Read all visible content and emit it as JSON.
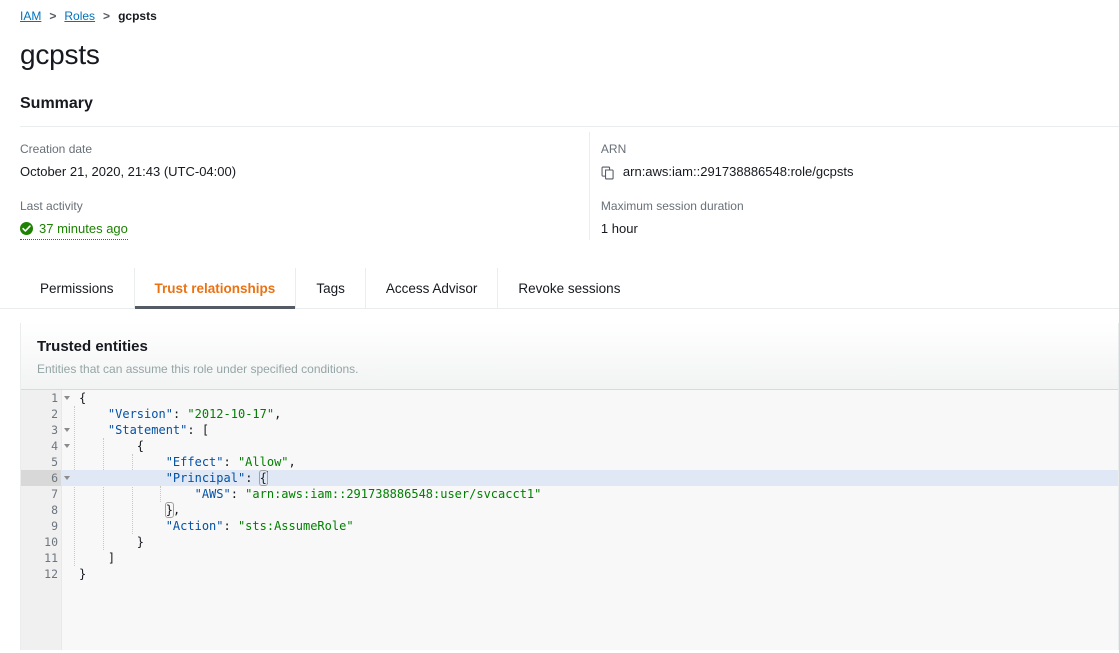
{
  "breadcrumb": {
    "items": [
      {
        "label": "IAM",
        "link": true
      },
      {
        "label": "Roles",
        "link": true
      },
      {
        "label": "gcpsts",
        "link": false
      }
    ],
    "separator": ">"
  },
  "page_title": "gcpsts",
  "summary": {
    "heading": "Summary",
    "left": {
      "creation_date_label": "Creation date",
      "creation_date_value": "October 21, 2020, 21:43 (UTC-04:00)",
      "last_activity_label": "Last activity",
      "last_activity_value": "37 minutes ago",
      "last_activity_icon": "check-circle-icon",
      "last_activity_color": "#1d8102"
    },
    "right": {
      "arn_label": "ARN",
      "arn_value": "arn:aws:iam::291738886548:role/gcpsts",
      "arn_copy_icon": "copy-icon",
      "max_session_label": "Maximum session duration",
      "max_session_value": "1 hour"
    }
  },
  "tabs": {
    "active_color": "#ec7211",
    "items": [
      {
        "label": "Permissions",
        "active": false
      },
      {
        "label": "Trust relationships",
        "active": true
      },
      {
        "label": "Tags",
        "active": false
      },
      {
        "label": "Access Advisor",
        "active": false
      },
      {
        "label": "Revoke sessions",
        "active": false
      }
    ]
  },
  "trusted_entities": {
    "title": "Trusted entities",
    "description": "Entities that can assume this role under specified conditions."
  },
  "editor": {
    "active_line": 6,
    "cursor_line": 6,
    "colors": {
      "key": "#0451a5",
      "string": "#008000",
      "active_line_bg": "#dfe8f4"
    },
    "lines": [
      {
        "n": 1,
        "fold": true,
        "indent": 0,
        "tokens": [
          {
            "t": "{",
            "c": "p"
          }
        ]
      },
      {
        "n": 2,
        "fold": false,
        "indent": 1,
        "tokens": [
          {
            "t": "\"Version\"",
            "c": "k"
          },
          {
            "t": ": ",
            "c": "p"
          },
          {
            "t": "\"2012-10-17\"",
            "c": "s"
          },
          {
            "t": ",",
            "c": "p"
          }
        ]
      },
      {
        "n": 3,
        "fold": true,
        "indent": 1,
        "tokens": [
          {
            "t": "\"Statement\"",
            "c": "k"
          },
          {
            "t": ": [",
            "c": "p"
          }
        ]
      },
      {
        "n": 4,
        "fold": true,
        "indent": 2,
        "tokens": [
          {
            "t": "{",
            "c": "p"
          }
        ]
      },
      {
        "n": 5,
        "fold": false,
        "indent": 3,
        "tokens": [
          {
            "t": "\"Effect\"",
            "c": "k"
          },
          {
            "t": ": ",
            "c": "p"
          },
          {
            "t": "\"Allow\"",
            "c": "s"
          },
          {
            "t": ",",
            "c": "p"
          }
        ]
      },
      {
        "n": 6,
        "fold": true,
        "indent": 3,
        "tokens": [
          {
            "t": "\"Principal\"",
            "c": "k"
          },
          {
            "t": ": ",
            "c": "p"
          },
          {
            "t": "{",
            "c": "p bracket"
          },
          {
            "t": "|cursor|",
            "c": "cursor"
          }
        ]
      },
      {
        "n": 7,
        "fold": false,
        "indent": 4,
        "tokens": [
          {
            "t": "\"AWS\"",
            "c": "k"
          },
          {
            "t": ": ",
            "c": "p"
          },
          {
            "t": "\"arn:aws:iam::291738886548:user/svcacct1\"",
            "c": "s"
          }
        ]
      },
      {
        "n": 8,
        "fold": false,
        "indent": 3,
        "tokens": [
          {
            "t": "}",
            "c": "p bracket"
          },
          {
            "t": ",",
            "c": "p"
          }
        ]
      },
      {
        "n": 9,
        "fold": false,
        "indent": 3,
        "tokens": [
          {
            "t": "\"Action\"",
            "c": "k"
          },
          {
            "t": ": ",
            "c": "p"
          },
          {
            "t": "\"sts:AssumeRole\"",
            "c": "s"
          }
        ]
      },
      {
        "n": 10,
        "fold": false,
        "indent": 2,
        "tokens": [
          {
            "t": "}",
            "c": "p"
          }
        ]
      },
      {
        "n": 11,
        "fold": false,
        "indent": 1,
        "tokens": [
          {
            "t": "]",
            "c": "p"
          }
        ]
      },
      {
        "n": 12,
        "fold": false,
        "indent": 0,
        "tokens": [
          {
            "t": "}",
            "c": "p"
          }
        ]
      }
    ]
  }
}
